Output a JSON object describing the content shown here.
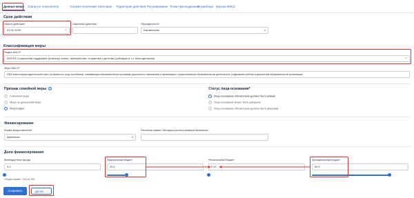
{
  "tabs": [
    {
      "label": "Данные меры",
      "active": true
    },
    {
      "label": "Этапы (от получателя)"
    },
    {
      "label": "Условия получения"
    },
    {
      "label": "Категория"
    },
    {
      "label": "Территория действия"
    },
    {
      "label": "Регулирование"
    },
    {
      "label": "Точка присоединения"
    },
    {
      "label": "Служебные"
    },
    {
      "label": "Версии КМСЗ"
    }
  ],
  "period": {
    "title": "Срок действия",
    "start_label": "Начало действия*",
    "start_value": "01.01.2020",
    "end_label": "Окончание действия",
    "end_value": "",
    "periodicity_label": "Периодичность*",
    "periodicity_value": "Ежемесячно"
  },
  "classification": {
    "title": "Классификация меры",
    "kmsz_label": "Раздел КМСЗ*",
    "kmsz_value": "000703 Социальная поддержка (помощь) семьи, материнства, отцовства и детства (субсидия в т.ч. многодетными)",
    "nkssp_label": "Мера НКССР",
    "nkssp_value": "0344 Компенсация родительской платы за присмотр и уход за ребенком, осваивающим образовательную программу дошкольного образования в организациях, осуществляющих образовательную деятельность (содержание ребенка в дошкольной образовательной организации)"
  },
  "family": {
    "title": "Признак семейной меры",
    "help": "?",
    "options": [
      "Семейная мера",
      "Мера по домохозяйствам",
      "Отсутствует"
    ],
    "selected": 2
  },
  "person_status": {
    "title": "Статус лица-основания*",
    "options": [
      "Лицо-основание обязательно должно быть живым",
      "Лицо-основание может быть умершим",
      "Лицо-основание обязательно должно быть умершим"
    ],
    "selected": 0
  },
  "financing": {
    "title": "Финансирование",
    "form_label": "Форма предоставления*",
    "form_value": "Денежная",
    "calc_label": "Расчетная сумма / Методика расчета размера назначения",
    "calc_value": ""
  },
  "shares": {
    "title": "Доли финансирования",
    "offbudget_label": "Внебюджетные фонды",
    "offbudget_value": "0,0",
    "offbudget_level": 0,
    "federal_label": "Федеральный бюджет",
    "federal_value": "20,0",
    "federal_level": 0.2,
    "regional_label": "Региональный бюджет",
    "regional_value": "0,00",
    "regional_level": 0,
    "municipal_label": "Муниципальный бюджет",
    "municipal_value": "80,0",
    "municipal_level": 0.8,
    "total_text": "Общая сумма*: 100 из 100"
  },
  "buttons": {
    "save": "Сохранить",
    "next": "Далее →"
  },
  "colors": {
    "accent": "#2f6fd0",
    "highlight": "#e0322b"
  }
}
